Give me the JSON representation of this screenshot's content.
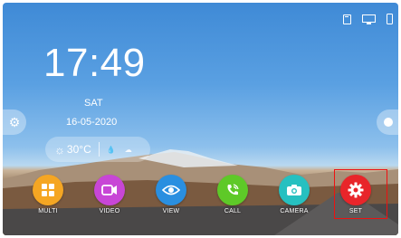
{
  "status_bar": {
    "icons": [
      "sd-card-icon",
      "monitor-icon",
      "phone-icon"
    ]
  },
  "clock": {
    "time": "17:49",
    "day": "SAT",
    "date": "16-05-2020"
  },
  "weather": {
    "icon": "sun-icon",
    "temperature": "30°C"
  },
  "dock": {
    "apps": [
      {
        "label": "MULTI",
        "icon": "grid-icon",
        "color": "#f5a623"
      },
      {
        "label": "VIDEO",
        "icon": "video-camera-icon",
        "color": "#c846d6"
      },
      {
        "label": "VIEW",
        "icon": "eye-icon",
        "color": "#2a8fe0"
      },
      {
        "label": "CALL",
        "icon": "phone-call-icon",
        "color": "#5ec928"
      },
      {
        "label": "CAMERA",
        "icon": "camera-icon",
        "color": "#26c0c0"
      },
      {
        "label": "SET",
        "icon": "gear-icon",
        "color": "#e8252a"
      }
    ],
    "selected": "SET"
  },
  "colors": {
    "selection_border": "#ee1111"
  }
}
